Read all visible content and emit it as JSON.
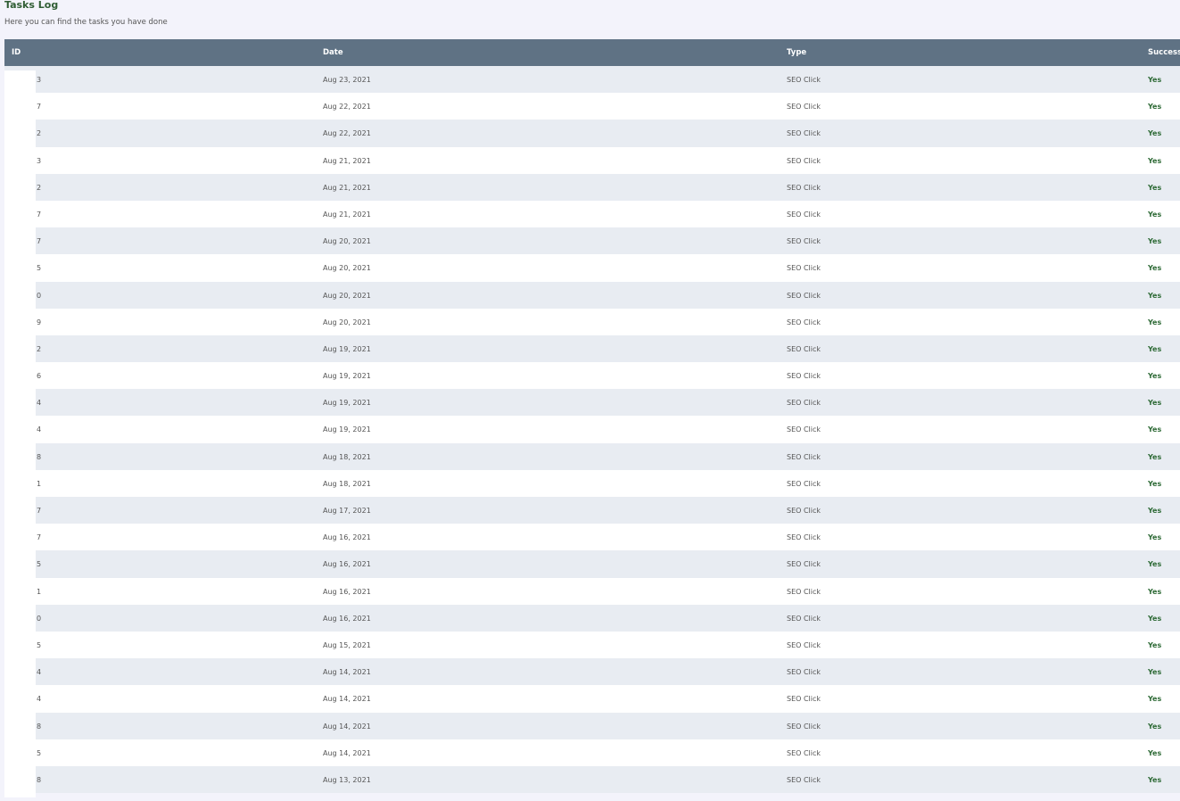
{
  "header": {
    "title": "Tasks Log",
    "subtitle": "Here you can find the tasks you have done"
  },
  "table": {
    "columns": [
      "ID",
      "Date",
      "Type",
      "Success"
    ],
    "rows": [
      {
        "id": "3",
        "date": "Aug 23, 2021",
        "type": "SEO Click",
        "success": "Yes"
      },
      {
        "id": "7",
        "date": "Aug 22, 2021",
        "type": "SEO Click",
        "success": "Yes"
      },
      {
        "id": "2",
        "date": "Aug 22, 2021",
        "type": "SEO Click",
        "success": "Yes"
      },
      {
        "id": "3",
        "date": "Aug 21, 2021",
        "type": "SEO Click",
        "success": "Yes"
      },
      {
        "id": "2",
        "date": "Aug 21, 2021",
        "type": "SEO Click",
        "success": "Yes"
      },
      {
        "id": "7",
        "date": "Aug 21, 2021",
        "type": "SEO Click",
        "success": "Yes"
      },
      {
        "id": "7",
        "date": "Aug 20, 2021",
        "type": "SEO Click",
        "success": "Yes"
      },
      {
        "id": "5",
        "date": "Aug 20, 2021",
        "type": "SEO Click",
        "success": "Yes"
      },
      {
        "id": "0",
        "date": "Aug 20, 2021",
        "type": "SEO Click",
        "success": "Yes"
      },
      {
        "id": "9",
        "date": "Aug 20, 2021",
        "type": "SEO Click",
        "success": "Yes"
      },
      {
        "id": "2",
        "date": "Aug 19, 2021",
        "type": "SEO Click",
        "success": "Yes"
      },
      {
        "id": "6",
        "date": "Aug 19, 2021",
        "type": "SEO Click",
        "success": "Yes"
      },
      {
        "id": "4",
        "date": "Aug 19, 2021",
        "type": "SEO Click",
        "success": "Yes"
      },
      {
        "id": "4",
        "date": "Aug 19, 2021",
        "type": "SEO Click",
        "success": "Yes"
      },
      {
        "id": "8",
        "date": "Aug 18, 2021",
        "type": "SEO Click",
        "success": "Yes"
      },
      {
        "id": "1",
        "date": "Aug 18, 2021",
        "type": "SEO Click",
        "success": "Yes"
      },
      {
        "id": "7",
        "date": "Aug 17, 2021",
        "type": "SEO Click",
        "success": "Yes"
      },
      {
        "id": "7",
        "date": "Aug 16, 2021",
        "type": "SEO Click",
        "success": "Yes"
      },
      {
        "id": "5",
        "date": "Aug 16, 2021",
        "type": "SEO Click",
        "success": "Yes"
      },
      {
        "id": "1",
        "date": "Aug 16, 2021",
        "type": "SEO Click",
        "success": "Yes"
      },
      {
        "id": "0",
        "date": "Aug 16, 2021",
        "type": "SEO Click",
        "success": "Yes"
      },
      {
        "id": "5",
        "date": "Aug 15, 2021",
        "type": "SEO Click",
        "success": "Yes"
      },
      {
        "id": "4",
        "date": "Aug 14, 2021",
        "type": "SEO Click",
        "success": "Yes"
      },
      {
        "id": "4",
        "date": "Aug 14, 2021",
        "type": "SEO Click",
        "success": "Yes"
      },
      {
        "id": "8",
        "date": "Aug 14, 2021",
        "type": "SEO Click",
        "success": "Yes"
      },
      {
        "id": "5",
        "date": "Aug 14, 2021",
        "type": "SEO Click",
        "success": "Yes"
      },
      {
        "id": "8",
        "date": "Aug 13, 2021",
        "type": "SEO Click",
        "success": "Yes"
      }
    ]
  },
  "colors": {
    "title": "#2f5d34",
    "header_bg": "#5f7284",
    "row_alt": "#e8ecf2",
    "success": "#2f6b37",
    "page_bg": "#f3f3fb"
  }
}
